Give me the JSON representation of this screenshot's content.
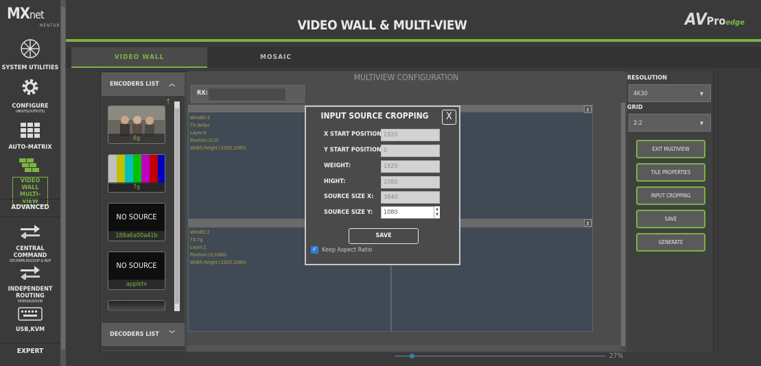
{
  "sidebar": {
    "logo": "MX",
    "logo_suffix": "net",
    "logo_sub": "MENTOR",
    "items": [
      {
        "label": "SYSTEM UTILITIES",
        "sub": "",
        "icon": "network-globe-icon"
      },
      {
        "label": "CONFIGURE",
        "sub": "(INPUTS/OUTPUTS)",
        "icon": "gear-icon"
      },
      {
        "label": "AUTO-MATRIX",
        "sub": "",
        "icon": "grid-icon"
      },
      {
        "label": "VIDEO WALL",
        "label2": "MULTI-VIEW",
        "sub": "",
        "icon": "video-wall-icon"
      },
      {
        "label": "CENTRAL COMMAND",
        "sub": "CEC/HDMI,RS232/IP & IR/IP",
        "icon": "arrows-icon"
      },
      {
        "label": "INDEPENDENT ROUTING",
        "sub": "VIDEO/AUDIO/IR",
        "icon": "arrows-icon"
      },
      {
        "label": "USB,KVM",
        "sub": "",
        "icon": "keyboard-icon"
      }
    ],
    "advanced": "ADVANCED",
    "expert": "EXPERT"
  },
  "header": {
    "title": "VIDEO WALL & MULTI-VIEW",
    "brand": "AV",
    "brand_pro": "Pro",
    "brand_edge": "edge"
  },
  "tabs": [
    {
      "label": "VIDEO WALL",
      "active": true
    },
    {
      "label": "MOSAIC",
      "active": false
    }
  ],
  "encoders": {
    "title": "ENCODERS LIST",
    "items": [
      {
        "name": "6g",
        "kind": "video"
      },
      {
        "name": "7g",
        "kind": "colorbars"
      },
      {
        "name": "188a6a00a41b",
        "kind": "nosource",
        "label": "NO SOURCE"
      },
      {
        "name": "appletv",
        "kind": "nosource",
        "label": "NO SOURCE"
      }
    ]
  },
  "decoders": {
    "title": "DECODERS LIST"
  },
  "multiview": {
    "title": "MULTIVIEW CONFIGURATION",
    "rx_label": "RX:",
    "windows": [
      {
        "lines": [
          "WindID:4",
          "TX:dellpc",
          "Layer:4",
          "Position:(0,0)",
          "Width,height:(1920,1080)"
        ]
      },
      {
        "lines": [
          "WindID:2",
          "TX:7g",
          "Layer:2",
          "Position:(0,1080)",
          "Width,height:(1920,1080)"
        ]
      }
    ],
    "close": "X"
  },
  "right": {
    "resolution_label": "RESOLUTION",
    "resolution_value": "4K30",
    "grid_label": "GRID",
    "grid_value": "2:2",
    "buttons": [
      "EXIT MULTIVIEW",
      "TILE PROPERTIES",
      "INPUT CROPPING",
      "SAVE",
      "GENERATE"
    ]
  },
  "zoom": {
    "value": "27%",
    "fraction": 0.08
  },
  "modal": {
    "title": "INPUT SOURCE CROPPING",
    "close": "X",
    "fields": [
      {
        "label": "X START POSITION:",
        "value": "1920"
      },
      {
        "label": "Y START POSITION:",
        "value": "0"
      },
      {
        "label": "WEIGHT:",
        "value": "1920"
      },
      {
        "label": "HIGHT:",
        "value": "1080"
      },
      {
        "label": "SOURCE SIZE X:",
        "value": "3840"
      },
      {
        "label": "SOURCE SIZE Y:",
        "value": "1080"
      }
    ],
    "save": "SAVE",
    "keep_aspect": "Keep Aspect Ratio",
    "keep_aspect_checked": true
  },
  "colors": {
    "accent": "#7cb342",
    "checkbox": "#2b7fd4"
  }
}
